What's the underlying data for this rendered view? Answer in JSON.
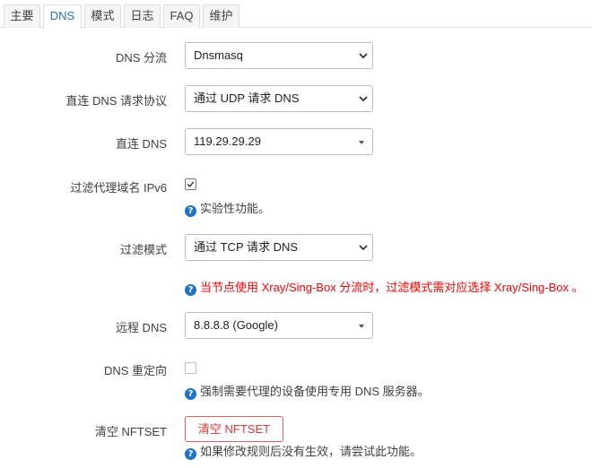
{
  "tabs": [
    {
      "label": "主要"
    },
    {
      "label": "DNS"
    },
    {
      "label": "模式"
    },
    {
      "label": "日志"
    },
    {
      "label": "FAQ"
    },
    {
      "label": "维护"
    }
  ],
  "active_tab": "DNS",
  "form": {
    "dns_shunt": {
      "label": "DNS 分流",
      "value": "Dnsmasq"
    },
    "direct_dns_protocol": {
      "label": "直连 DNS 请求协议",
      "value": "通过 UDP 请求 DNS"
    },
    "direct_dns": {
      "label": "直连 DNS",
      "value": "119.29.29.29"
    },
    "filter_ipv6": {
      "label": "过滤代理域名 IPv6",
      "checked": true,
      "help": "实验性功能。"
    },
    "filter_mode": {
      "label": "过滤模式",
      "value": "通过 TCP 请求 DNS",
      "help": "当节点使用 Xray/Sing-Box 分流时，过滤模式需对应选择 Xray/Sing-Box 。"
    },
    "remote_dns": {
      "label": "远程 DNS",
      "value": "8.8.8.8 (Google)"
    },
    "dns_redirect": {
      "label": "DNS 重定向",
      "checked": false,
      "help": "强制需要代理的设备使用专用 DNS 服务器。"
    },
    "clear_nftset": {
      "label": "清空 NFTSET",
      "button": "清空 NFTSET",
      "help": "如果修改规则后没有生效，请尝试此功能。"
    }
  },
  "help_icon_glyph": "?",
  "colors": {
    "accent": "#2a6fb9",
    "help_icon": "#1e73c2",
    "warning_text": "#ff0000",
    "danger_button": "#d63c3c"
  }
}
